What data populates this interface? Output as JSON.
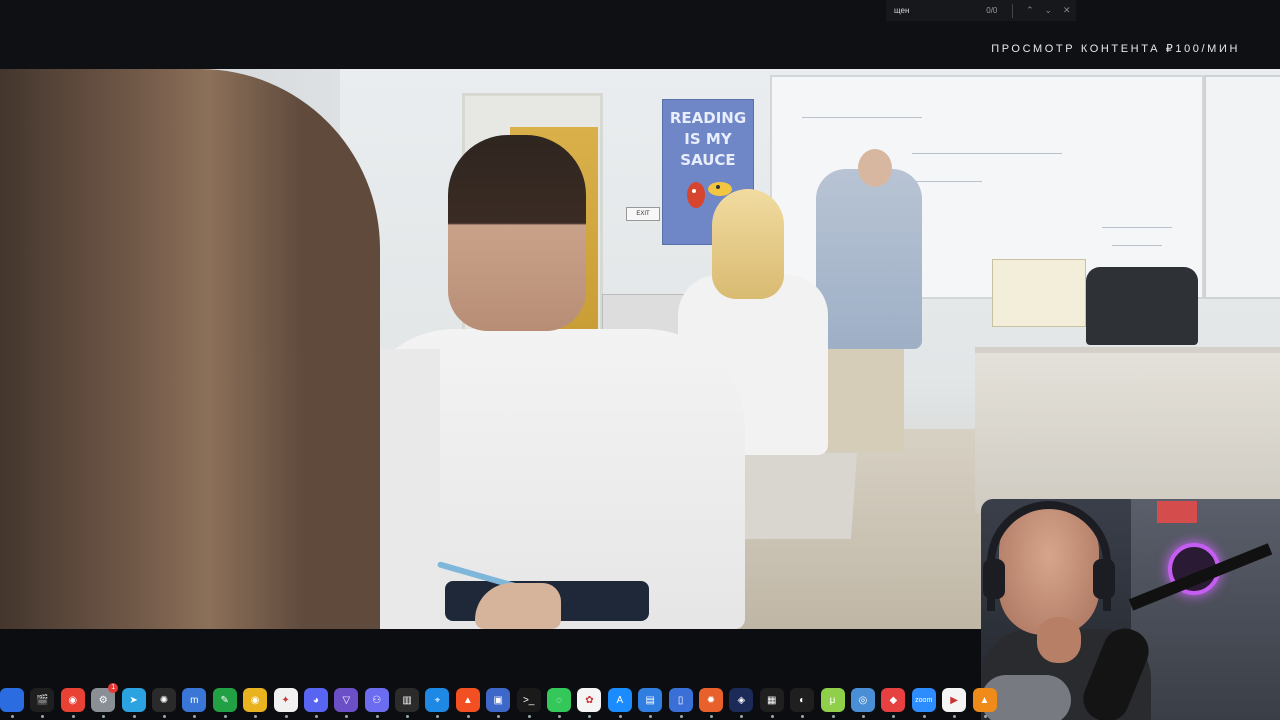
{
  "find_bar": {
    "query": "щен",
    "count": "0/0",
    "prev_icon": "⌃",
    "next_icon": "⌄",
    "close_icon": "✕"
  },
  "overlay": {
    "price_label": "ПРОСМОТР КОНТЕНТА ₽100/МИН"
  },
  "video": {
    "poster_lines": [
      "READING",
      "IS MY",
      "SAUCE"
    ],
    "exit_sign": "EXIT"
  },
  "dock": {
    "icons": [
      {
        "name": "app-icon",
        "color": "#2b6de0",
        "glyph": ""
      },
      {
        "name": "claquette-icon",
        "color": "#1f1f1f",
        "glyph": "🎬"
      },
      {
        "name": "chrome-icon",
        "color": "#e94235",
        "glyph": "◉"
      },
      {
        "name": "system-settings-icon",
        "color": "#8a8f96",
        "glyph": "⚙",
        "badge": "1"
      },
      {
        "name": "telegram-icon",
        "color": "#2aa3e0",
        "glyph": "➤"
      },
      {
        "name": "chatgpt-icon",
        "color": "#2a2a2a",
        "glyph": "✺"
      },
      {
        "name": "meld-icon",
        "color": "#3a76d6",
        "glyph": "m"
      },
      {
        "name": "evernote-icon",
        "color": "#21a044",
        "glyph": "✎"
      },
      {
        "name": "chrome-canary-icon",
        "color": "#e9b320",
        "glyph": "◉"
      },
      {
        "name": "pixelmator-icon",
        "color": "#f1f1f1",
        "glyph": "✦"
      },
      {
        "name": "discord-icon",
        "color": "#5865f2",
        "glyph": "◕"
      },
      {
        "name": "proton-vpn-icon",
        "color": "#6b4fc6",
        "glyph": "▽"
      },
      {
        "name": "pipe-app-icon",
        "color": "#6c6cf0",
        "glyph": "⚇"
      },
      {
        "name": "piano-icon",
        "color": "#2b2b2b",
        "glyph": "▥"
      },
      {
        "name": "safari-icon",
        "color": "#1e88e5",
        "glyph": "⌖"
      },
      {
        "name": "brave-icon",
        "color": "#f25022",
        "glyph": "▲"
      },
      {
        "name": "klack-icon",
        "color": "#3d67c9",
        "glyph": "▣"
      },
      {
        "name": "terminal-icon",
        "color": "#1a1a1a",
        "glyph": ">_"
      },
      {
        "name": "messages-icon",
        "color": "#34c759",
        "glyph": "◌"
      },
      {
        "name": "photos-icon",
        "color": "#f5f5f5",
        "glyph": "✿"
      },
      {
        "name": "app-store-icon",
        "color": "#1a8cff",
        "glyph": "A"
      },
      {
        "name": "finder-folder-icon",
        "color": "#2f7ee0",
        "glyph": "▤"
      },
      {
        "name": "simulator-icon",
        "color": "#3b6fd8",
        "glyph": "▯"
      },
      {
        "name": "figma-burst-icon",
        "color": "#e8612c",
        "glyph": "✹"
      },
      {
        "name": "vpn-shield-icon",
        "color": "#1c2a57",
        "glyph": "◈"
      },
      {
        "name": "clapper-icon",
        "color": "#1f1f1f",
        "glyph": "▦"
      },
      {
        "name": "screen-recorder-icon",
        "color": "#1f1f1f",
        "glyph": "◐"
      },
      {
        "name": "torrent-icon",
        "color": "#8fcf4a",
        "glyph": "μ"
      },
      {
        "name": "network-icon",
        "color": "#4a8fd6",
        "glyph": "◎"
      },
      {
        "name": "sketch-icon",
        "color": "#e64040",
        "glyph": "◆"
      },
      {
        "name": "zoom-icon",
        "color": "#2d8cff",
        "glyph": "zoom"
      },
      {
        "name": "youtube-icon",
        "color": "#f5f5f5",
        "glyph": "▶"
      },
      {
        "name": "vlc-icon",
        "color": "#f08a18",
        "glyph": "▲"
      }
    ]
  }
}
